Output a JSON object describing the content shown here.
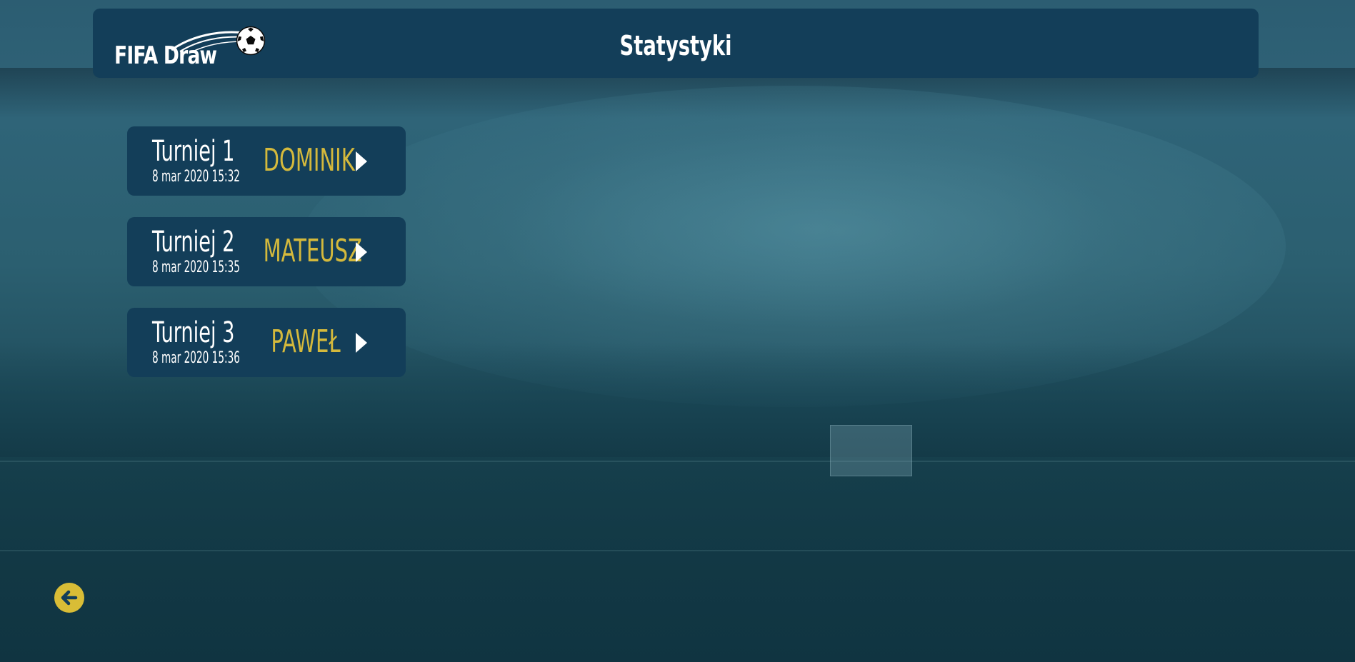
{
  "app": {
    "logo_text": "FIFA Draw",
    "logo_icon": "soccer-ball-icon"
  },
  "header": {
    "title": "Statystyki"
  },
  "tournaments": [
    {
      "name": "Turniej 1",
      "date": "8 mar 2020 15:32",
      "winner": "DOMINIK"
    },
    {
      "name": "Turniej 2",
      "date": "8 mar 2020 15:35",
      "winner": "MATEUSZ"
    },
    {
      "name": "Turniej 3",
      "date": "8 mar 2020 15:36",
      "winner": "PAWEŁ"
    }
  ],
  "icons": {
    "open_tournament": "play-arrow-icon",
    "back": "arrow-left-circle-icon"
  },
  "colors": {
    "panel": "#133e59",
    "accent": "#d4b93c",
    "text": "#ffffff"
  }
}
